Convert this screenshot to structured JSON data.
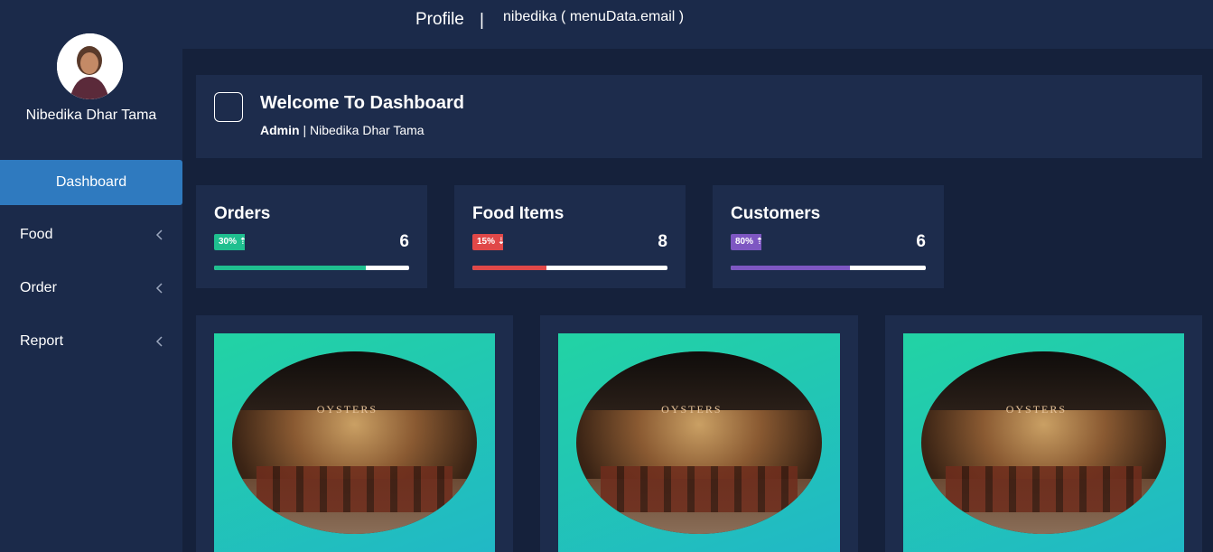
{
  "header": {
    "profile_label": "Profile",
    "separator": "|",
    "user_email_text": "nibedika ( menuData.email )"
  },
  "sidebar": {
    "user_name": "Nibedika Dhar Tama",
    "items": [
      {
        "label": "Dashboard",
        "active": true
      },
      {
        "label": "Food",
        "icon": "chevron-left-icon"
      },
      {
        "label": "Order",
        "icon": "chevron-left-icon"
      },
      {
        "label": "Report",
        "icon": "chevron-left-icon"
      }
    ]
  },
  "welcome": {
    "title": "Welcome To Dashboard",
    "role": "Admin",
    "separator": " | ",
    "name": "Nibedika Dhar Tama"
  },
  "stats": [
    {
      "title": "Orders",
      "badge": "30% ⇡",
      "value": "6",
      "progress": 0.78,
      "color": "#1fbf8f"
    },
    {
      "title": "Food Items",
      "badge": "15% ⇣",
      "value": "8",
      "progress": 0.38,
      "color": "#e04848"
    },
    {
      "title": "Customers",
      "badge": "80% ⇡",
      "value": "6",
      "progress": 0.61,
      "color": "#7e57c2"
    }
  ],
  "cards": [
    {
      "image": "restaurant-interior",
      "sign_text": "OYSTERS"
    },
    {
      "image": "restaurant-interior",
      "sign_text": "OYSTERS"
    },
    {
      "image": "restaurant-interior",
      "sign_text": "OYSTERS"
    }
  ]
}
